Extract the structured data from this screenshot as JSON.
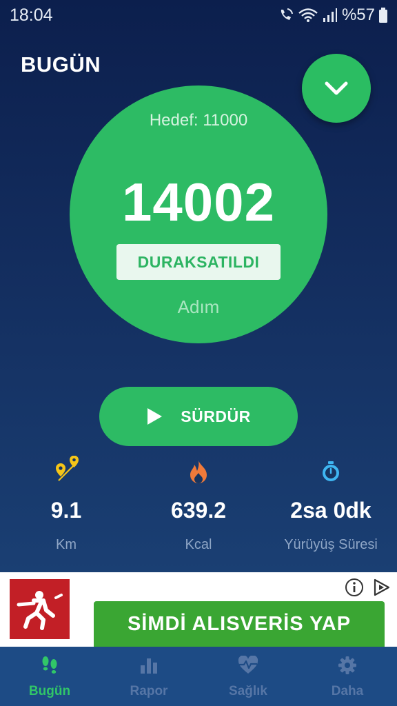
{
  "status_bar": {
    "time": "18:04",
    "battery": "%57"
  },
  "header": {
    "title": "BUGÜN",
    "collapse_icon": "chevron-down-icon"
  },
  "step_panel": {
    "goal": "Hedef: 11000",
    "steps": "14002",
    "state": "DURAKSATILDI",
    "unit": "Adım"
  },
  "resume_button": {
    "label": "SÜRDÜR",
    "icon": "play-icon"
  },
  "stats": [
    {
      "icon": "route-pin-icon",
      "value": "9.1",
      "label": "Km",
      "color": "#f5c518"
    },
    {
      "icon": "flame-icon",
      "value": "639.2",
      "label": "Kcal",
      "color": "#f07a3a"
    },
    {
      "icon": "stopwatch-icon",
      "value": "2sa 0dk",
      "label": "Yürüyüş Süresi",
      "color": "#3fb6f2"
    }
  ],
  "ad": {
    "cta": "SİMDİ ALISVERİS YAP"
  },
  "bottom_nav": [
    {
      "label": "Bugün",
      "icon": "footsteps-icon",
      "active": true
    },
    {
      "label": "Rapor",
      "icon": "bar-chart-icon",
      "active": false
    },
    {
      "label": "Sağlık",
      "icon": "heart-pulse-icon",
      "active": false
    },
    {
      "label": "Daha",
      "icon": "gear-icon",
      "active": false
    }
  ],
  "colors": {
    "accent": "#2dbb64",
    "background": "#132d5e",
    "nav_inactive": "#5676a6"
  }
}
